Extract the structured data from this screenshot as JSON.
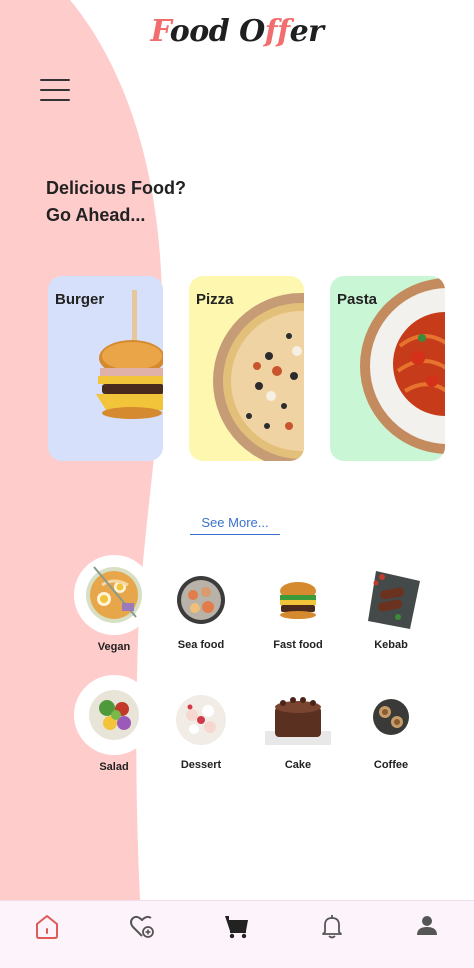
{
  "header": {
    "logo_part1": "F",
    "logo_part2": "ood O",
    "logo_part3": "ff",
    "logo_part4": "er"
  },
  "hero": {
    "line1": "Delicious Food?",
    "line2": "Go Ahead..."
  },
  "featured_cards": [
    {
      "label": "Burger",
      "color": "#d6e0fa"
    },
    {
      "label": "Pizza",
      "color": "#fdf7b0"
    },
    {
      "label": "Pasta",
      "color": "#c9f6d4"
    }
  ],
  "see_more_label": "See More...",
  "categories": [
    {
      "label": "Vegan",
      "icon": "noodle-bowl-icon"
    },
    {
      "label": "Sea food",
      "icon": "seafood-plate-icon"
    },
    {
      "label": "Fast food",
      "icon": "burger-icon"
    },
    {
      "label": "Kebab",
      "icon": "kebab-plate-icon"
    },
    {
      "label": "Salad",
      "icon": "salad-bowl-icon"
    },
    {
      "label": "Dessert",
      "icon": "dessert-plate-icon"
    },
    {
      "label": "Cake",
      "icon": "cake-icon"
    },
    {
      "label": "Coffee",
      "icon": "coffee-cups-icon"
    }
  ],
  "bottom_nav": [
    {
      "name": "home",
      "icon": "home-icon",
      "active": true
    },
    {
      "name": "favorites",
      "icon": "heart-plus-icon"
    },
    {
      "name": "cart",
      "icon": "cart-icon"
    },
    {
      "name": "notifications",
      "icon": "bell-icon"
    },
    {
      "name": "profile",
      "icon": "user-icon"
    }
  ],
  "colors": {
    "wave_pink": "#ffcccc",
    "accent": "#f26d6d",
    "link": "#3a72c9",
    "nav_bg": "#fdf4fb"
  }
}
